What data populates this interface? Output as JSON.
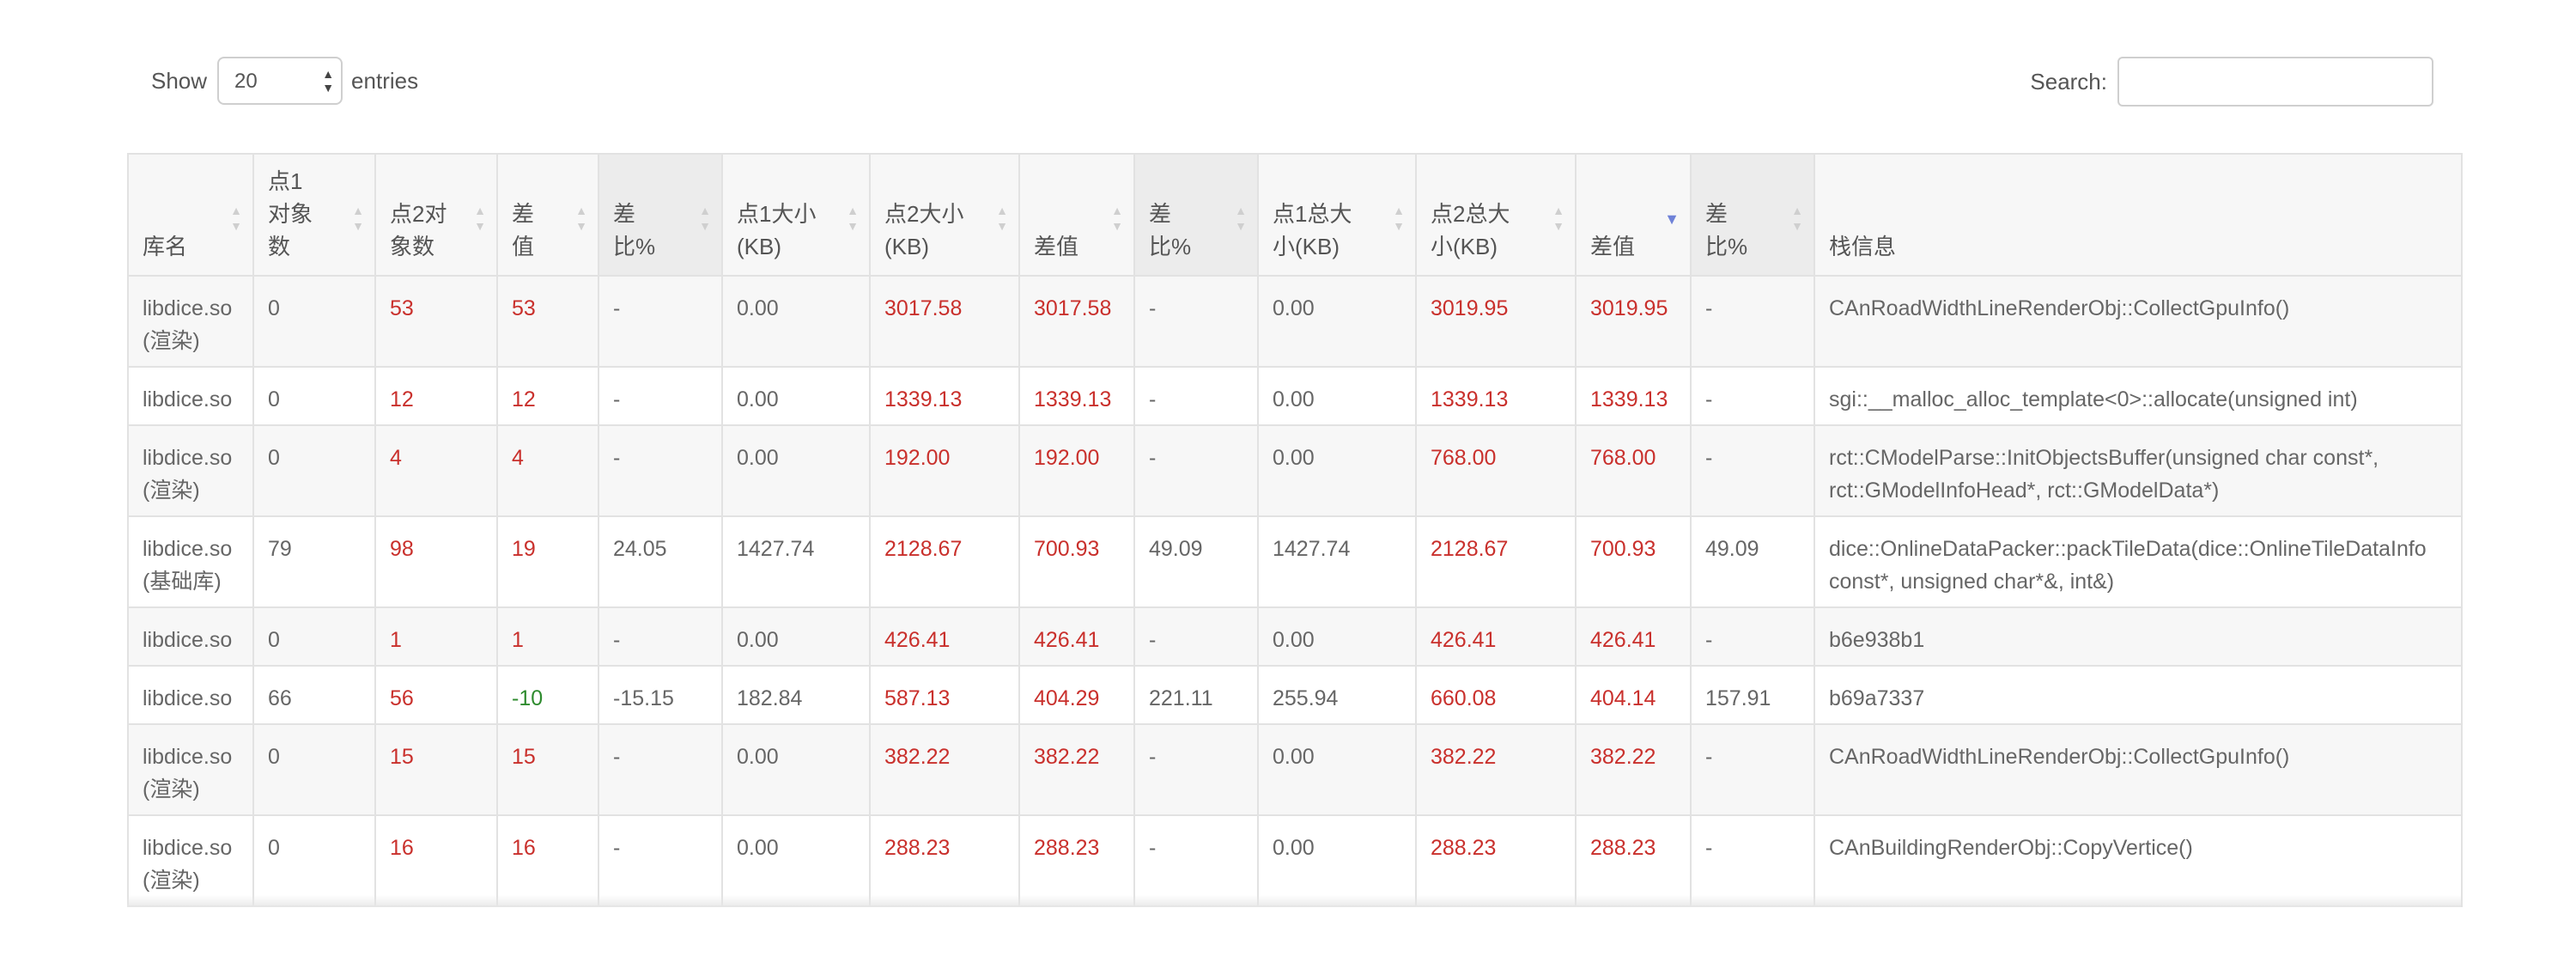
{
  "controls": {
    "show_label": "Show",
    "entries_value": "20",
    "entries_label": "entries",
    "search_label": "Search:",
    "search_value": ""
  },
  "table": {
    "columns": [
      "库名",
      "点1对象数",
      "点2对象数",
      "差值",
      "差比%",
      "点1大小(KB)",
      "点2大小(KB)",
      "差值",
      "差比%",
      "点1总大小(KB)",
      "点2总大小(KB)",
      "差值",
      "差比%",
      "栈信息"
    ],
    "column_lines": [
      [
        "库名"
      ],
      [
        "点1",
        "对象",
        "数"
      ],
      [
        "点2对",
        "象数"
      ],
      [
        "差",
        "值"
      ],
      [
        "差",
        "比%"
      ],
      [
        "点1大小",
        "(KB)"
      ],
      [
        "点2大小",
        "(KB)"
      ],
      [
        "差值"
      ],
      [
        "差",
        "比%"
      ],
      [
        "点1总大",
        "小(KB)"
      ],
      [
        "点2总大",
        "小(KB)"
      ],
      [
        "差值"
      ],
      [
        "差",
        "比%"
      ],
      [
        "栈信息"
      ]
    ],
    "sorted_column_index": 11,
    "sort_direction": "desc",
    "rows": [
      [
        "libdice.so (渲染)",
        "0",
        "53",
        "53",
        "-",
        "0.00",
        "3017.58",
        "3017.58",
        "-",
        "0.00",
        "3019.95",
        "3019.95",
        "-",
        "CAnRoadWidthLineRenderObj::CollectGpuInfo()"
      ],
      [
        "libdice.so",
        "0",
        "12",
        "12",
        "-",
        "0.00",
        "1339.13",
        "1339.13",
        "-",
        "0.00",
        "1339.13",
        "1339.13",
        "-",
        "sgi::__malloc_alloc_template<0>::allocate(unsigned int)"
      ],
      [
        "libdice.so (渲染)",
        "0",
        "4",
        "4",
        "-",
        "0.00",
        "192.00",
        "192.00",
        "-",
        "0.00",
        "768.00",
        "768.00",
        "-",
        "rct::CModelParse::InitObjectsBuffer(unsigned char const*, rct::GModelInfoHead*, rct::GModelData*)"
      ],
      [
        "libdice.so (基础库)",
        "79",
        "98",
        "19",
        "24.05",
        "1427.74",
        "2128.67",
        "700.93",
        "49.09",
        "1427.74",
        "2128.67",
        "700.93",
        "49.09",
        "dice::OnlineDataPacker::packTileData(dice::OnlineTileDataInfo const*, unsigned char*&, int&)"
      ],
      [
        "libdice.so",
        "0",
        "1",
        "1",
        "-",
        "0.00",
        "426.41",
        "426.41",
        "-",
        "0.00",
        "426.41",
        "426.41",
        "-",
        "b6e938b1"
      ],
      [
        "libdice.so",
        "66",
        "56",
        "-10",
        "-15.15",
        "182.84",
        "587.13",
        "404.29",
        "221.11",
        "255.94",
        "660.08",
        "404.14",
        "157.91",
        "b69a7337"
      ],
      [
        "libdice.so (渲染)",
        "0",
        "15",
        "15",
        "-",
        "0.00",
        "382.22",
        "382.22",
        "-",
        "0.00",
        "382.22",
        "382.22",
        "-",
        "CAnRoadWidthLineRenderObj::CollectGpuInfo()"
      ],
      [
        "libdice.so (渲染)",
        "0",
        "16",
        "16",
        "-",
        "0.00",
        "288.23",
        "288.23",
        "-",
        "0.00",
        "288.23",
        "288.23",
        "-",
        "CAnBuildingRenderObj::CopyVertice()"
      ]
    ],
    "cell_colors": [
      [
        "",
        "",
        "red",
        "red",
        "",
        "",
        "red",
        "red",
        "",
        "",
        "red",
        "red",
        "",
        ""
      ],
      [
        "",
        "",
        "red",
        "red",
        "",
        "",
        "red",
        "red",
        "",
        "",
        "red",
        "red",
        "",
        ""
      ],
      [
        "",
        "",
        "red",
        "red",
        "",
        "",
        "red",
        "red",
        "",
        "",
        "red",
        "red",
        "",
        ""
      ],
      [
        "",
        "",
        "red",
        "red",
        "",
        "",
        "red",
        "red",
        "",
        "",
        "red",
        "red",
        "",
        ""
      ],
      [
        "",
        "",
        "red",
        "red",
        "",
        "",
        "red",
        "red",
        "",
        "",
        "red",
        "red",
        "",
        ""
      ],
      [
        "",
        "",
        "red",
        "green",
        "",
        "",
        "red",
        "red",
        "",
        "",
        "red",
        "red",
        "",
        ""
      ],
      [
        "",
        "",
        "red",
        "red",
        "",
        "",
        "red",
        "red",
        "",
        "",
        "red",
        "red",
        "",
        ""
      ],
      [
        "",
        "",
        "red",
        "red",
        "",
        "",
        "red",
        "red",
        "",
        "",
        "red",
        "red",
        "",
        ""
      ]
    ],
    "colors": {
      "increase": "#c9302c",
      "decrease": "#2e8b2e",
      "sort_active": "#6f82d8"
    }
  }
}
